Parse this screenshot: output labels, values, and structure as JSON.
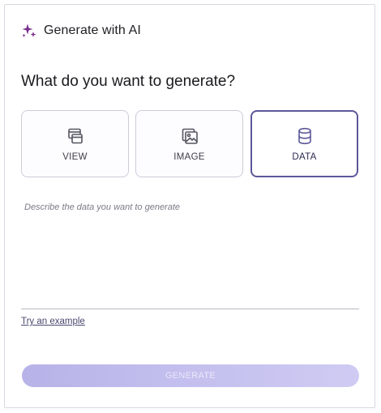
{
  "header": {
    "icon": "sparkle-icon",
    "title": "Generate with AI",
    "accent_color": "#7b2f8f"
  },
  "question": "What do you want to generate?",
  "options": [
    {
      "label": "VIEW",
      "icon": "window-stack-icon",
      "selected": false
    },
    {
      "label": "IMAGE",
      "icon": "image-icon",
      "selected": false
    },
    {
      "label": "DATA",
      "icon": "database-icon",
      "selected": true
    }
  ],
  "description": {
    "value": "",
    "placeholder": "Describe the data you want to generate"
  },
  "example_link": "Try an example",
  "generate": {
    "label": "GENERATE",
    "disabled": true,
    "color": "#b7b3e8"
  },
  "colors": {
    "selected_border": "#5b5899",
    "border": "#cfcbd8"
  }
}
